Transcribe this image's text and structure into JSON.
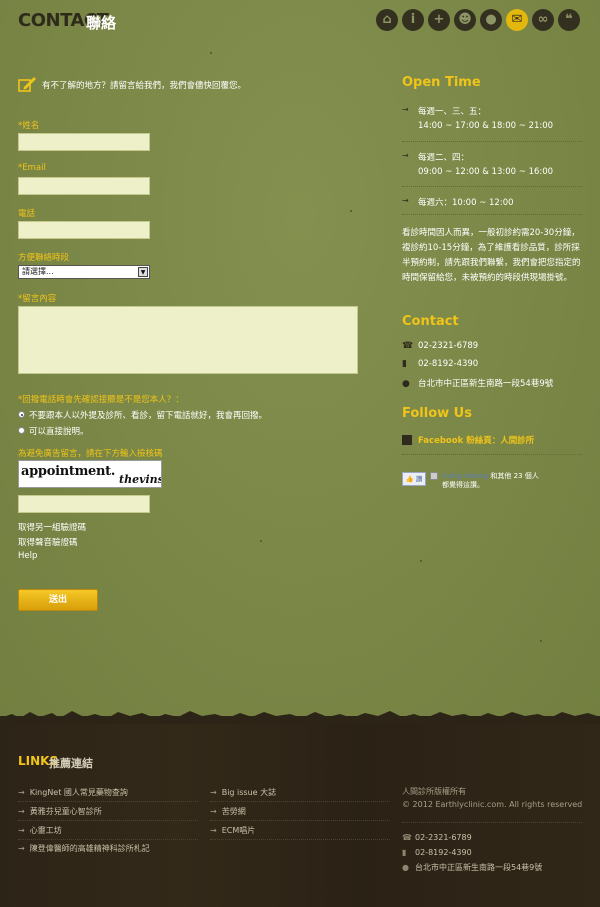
{
  "header": {
    "title_en": "CONTACT",
    "title_zh": "聯絡",
    "nav_icons": [
      {
        "name": "home-icon",
        "glyph": "⌂",
        "active": false
      },
      {
        "name": "info-icon",
        "glyph": "i",
        "active": false
      },
      {
        "name": "medical-cross-icon",
        "glyph": "+",
        "active": false
      },
      {
        "name": "team-icon",
        "glyph": "☻",
        "active": false
      },
      {
        "name": "location-pin-icon",
        "glyph": "●",
        "active": false
      },
      {
        "name": "mail-icon",
        "glyph": "✉",
        "active": true
      },
      {
        "name": "link-icon",
        "glyph": "∞",
        "active": false
      },
      {
        "name": "chat-icon",
        "glyph": "❝",
        "active": false
      }
    ]
  },
  "form": {
    "intro": "有不了解的地方？請留言給我們，我們會儘快回覆您。",
    "name_label": "*姓名",
    "email_label": "*Email",
    "phone_label": "電話",
    "time_label": "方便聯絡時段",
    "time_select_value": "請選擇...",
    "message_label": "*留言內容",
    "confirm_question": "*回撥電話時會先確認接聽是不是您本人？：",
    "radio_options": [
      {
        "label": "不要跟本人以外提及診所、看診，留下電話就好，我會再回撥。",
        "checked": true
      },
      {
        "label": "可以直接說明。",
        "checked": false
      }
    ],
    "captcha_prompt": "為避免廣告留言，請在下方輸入檢核碼",
    "captcha_word1": "appointment.",
    "captcha_word2": "thevins",
    "new_captcha_link": "取得另一組驗證碼",
    "audio_captcha_link": "取得聲音驗證碼",
    "help_link": "Help",
    "submit_label": "送出"
  },
  "sidebar": {
    "open_time_title": "Open Time",
    "schedule": [
      {
        "days": "每週一、三、五：",
        "hours": "14:00 ~ 17:00 & 18:00 ~ 21:00"
      },
      {
        "days": "每週二、四：",
        "hours": "09:00 ~ 12:00 & 13:00 ~ 16:00"
      },
      {
        "days": "每週六：10:00 ~ 12:00",
        "hours": ""
      }
    ],
    "note": "看診時間因人而異，一般初診約需20-30分鐘，複診約10-15分鐘，為了維護看診品質，診所採半預約制，請先跟我們聯繫，我們會把您指定的時間保留給您，未被預約的時段供現場掛號。",
    "contact_title": "Contact",
    "phone1": "02-2321-6789",
    "phone2": "02-8192-4390",
    "address": "台北市中正區新生南路一段54巷9號",
    "follow_title": "Follow Us",
    "facebook_label": "Facebook",
    "facebook_page": "粉絲頁：人間診所",
    "like_button": "讚",
    "like_name": "Irving Hsiang",
    "like_text_a": "和其他 23 個人",
    "like_text_b": "都覺得這讚。"
  },
  "footer": {
    "links_title": "LINKS",
    "links_zh": "推薦連結",
    "links_col1": [
      "KingNet 國人常見藥物查詢",
      "黃雅芬兒童心智診所",
      "心靈工坊",
      "陳登偉醫師的高雄精神科診所札記"
    ],
    "links_col2": [
      "Big issue 大誌",
      "苦勞網",
      "ECM唱片"
    ],
    "copyright_zh": "人間診所版權所有",
    "copyright_en": "© 2012 Earthlyclinic.com. All rights reserved",
    "phone1": "02-2321-6789",
    "phone2": "02-8192-4390",
    "address": "台北市中正區新生南路一段54巷9號"
  },
  "colors": {
    "accent": "#f0c419",
    "background": "#7d8a49",
    "footer": "#2d2418"
  }
}
